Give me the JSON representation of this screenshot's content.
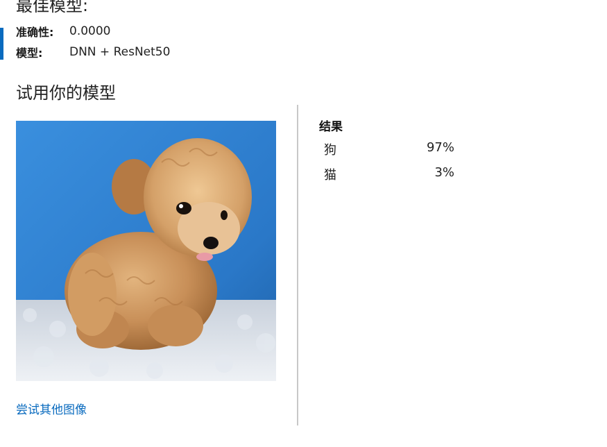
{
  "best_model": {
    "title": "最佳模型:",
    "accuracy_label": "准确性:",
    "accuracy_value": "0.0000",
    "model_label": "模型:",
    "model_value": "DNN + ResNet50"
  },
  "try_model": {
    "title": "试用你的模型",
    "try_other_link": "尝试其他图像"
  },
  "results": {
    "heading": "结果",
    "items": [
      {
        "label": "狗",
        "value": "97%"
      },
      {
        "label": "猫",
        "value": "3%"
      }
    ]
  },
  "colors": {
    "accent": "#0a6bbf",
    "photo_background": "#2f86d8"
  },
  "icons": {
    "uploaded_image": "puppy-photo"
  }
}
